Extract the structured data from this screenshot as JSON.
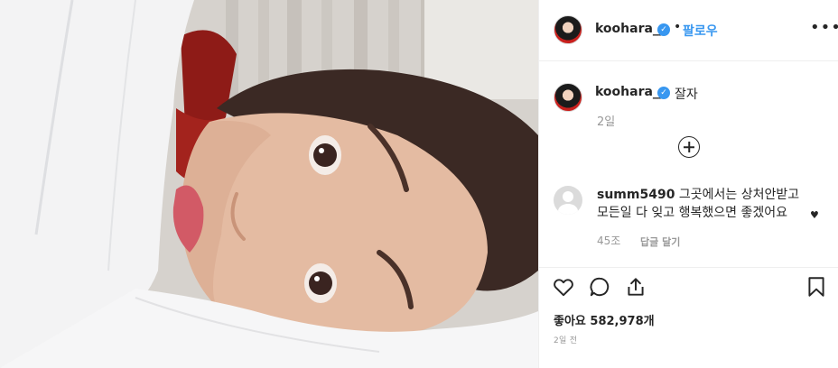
{
  "post": {
    "username": "koohara__",
    "verified_glyph": "✓",
    "follow_dot": "•",
    "follow_label": "팔로우",
    "more_label": "•••",
    "caption_text": "잘자",
    "caption_time": "2일",
    "likes_label": "좋아요",
    "likes_count": "582,978개",
    "posted_time": "2일 전"
  },
  "comment": {
    "username": "summ5490",
    "text": "그곳에서는 상처안받고 모든일 다 잊고 행복했으면 좋겠어요",
    "heart": "♥",
    "likes": "45조",
    "reply_label": "답글 달기"
  },
  "icons": {
    "header_more": "more-options-icon",
    "load_more": "plus-circle-icon",
    "like": "heart-icon",
    "comment": "comment-bubble-icon",
    "share": "share-icon",
    "save": "bookmark-icon"
  },
  "colors": {
    "link_blue": "#3897f0",
    "text": "#262626",
    "muted": "#999999",
    "divider": "#efefef"
  }
}
